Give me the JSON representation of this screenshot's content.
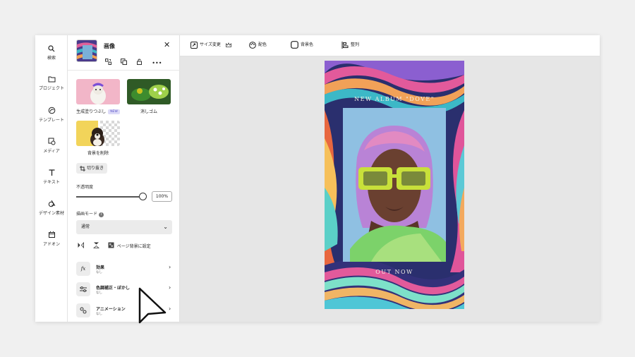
{
  "rail": {
    "items": [
      {
        "icon": "search-icon",
        "label": "検索"
      },
      {
        "icon": "folder-icon",
        "label": "プロジェクト"
      },
      {
        "icon": "template-icon",
        "label": "テンプレート"
      },
      {
        "icon": "media-icon",
        "label": "メディア"
      },
      {
        "icon": "text-icon",
        "label": "テキスト"
      },
      {
        "icon": "design-assets-icon",
        "label": "デザイン素材"
      },
      {
        "icon": "addon-icon",
        "label": "アドオン"
      }
    ]
  },
  "panel": {
    "title": "画像",
    "cards": [
      {
        "label": "生成塗りつぶし",
        "badge": "NEW"
      },
      {
        "label": "消しゴム"
      },
      {
        "label": "背景を削除"
      }
    ],
    "crop_label": "切り抜き",
    "opacity_label": "不透明度",
    "opacity_value": "100%",
    "opacity_fraction": 1.0,
    "blend_label": "描画モード",
    "blend_value": "通常",
    "page_bg_label": "ページ背景に設定",
    "effects": [
      {
        "icon": "fx-icon",
        "title": "効果",
        "sub": "なし"
      },
      {
        "icon": "adjust-icon",
        "title": "色調補正・ぼかし",
        "sub": "なし"
      },
      {
        "icon": "animation-icon",
        "title": "アニメーション",
        "sub": "なし"
      }
    ]
  },
  "toolbar": {
    "resize": "サイズ変更",
    "palette": "配色",
    "bg_color": "背景色",
    "align": "整列"
  },
  "artboard": {
    "headline": "NEW ALBUM \"DOVE\"",
    "footer": "OUT NOW"
  },
  "colors": {
    "accent": "#5b55c9",
    "canvas": "#e6e6e6"
  }
}
